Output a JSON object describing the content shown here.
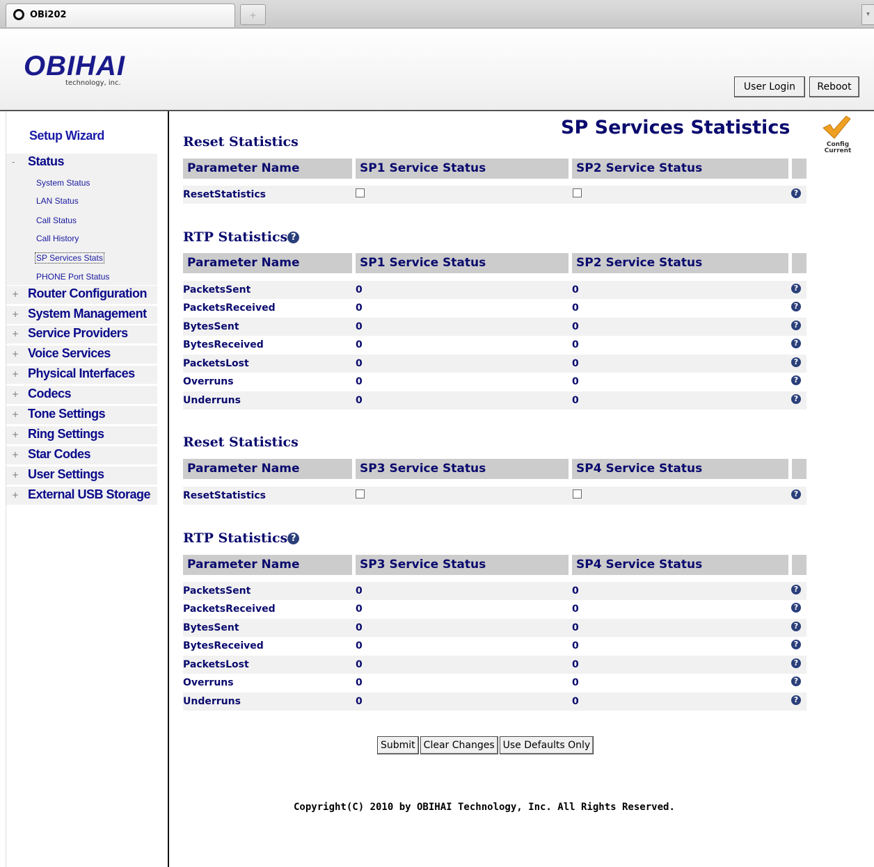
{
  "browser": {
    "tab_title": "OBi202",
    "new_tab": "+",
    "scroll": "▾"
  },
  "header": {
    "logo": "OBIHAI",
    "logo_sub": "technology, inc.",
    "user_login": "User Login",
    "reboot": "Reboot"
  },
  "sidebar": {
    "setup_wizard": "Setup Wizard",
    "status": {
      "label": "Status",
      "toggle": "-"
    },
    "status_items": [
      "System Status",
      "LAN Status",
      "Call Status",
      "Call History",
      "SP Services Stats",
      "PHONE Port Status"
    ],
    "active_item": "SP Services Stats",
    "groups": [
      "Router Configuration",
      "System Management",
      "Service Providers",
      "Voice Services",
      "Physical Interfaces",
      "Codecs",
      "Tone Settings",
      "Ring Settings",
      "Star Codes",
      "User Settings",
      "External USB Storage"
    ],
    "group_toggle": "+"
  },
  "main": {
    "page_title": "SP Services Statistics",
    "config_status": "Config Current",
    "help_glyph": "?",
    "header_param": "Parameter Name",
    "reset_title": "Reset Statistics",
    "rtp_title": "RTP Statistics",
    "block1": {
      "col_a": "SP1 Service Status",
      "col_b": "SP2 Service Status",
      "reset_param": "ResetStatistics",
      "reset_a_checked": false,
      "reset_b_checked": false,
      "rtp_rows": [
        {
          "name": "PacketsSent",
          "a": "0",
          "b": "0"
        },
        {
          "name": "PacketsReceived",
          "a": "0",
          "b": "0"
        },
        {
          "name": "BytesSent",
          "a": "0",
          "b": "0"
        },
        {
          "name": "BytesReceived",
          "a": "0",
          "b": "0"
        },
        {
          "name": "PacketsLost",
          "a": "0",
          "b": "0"
        },
        {
          "name": "Overruns",
          "a": "0",
          "b": "0"
        },
        {
          "name": "Underruns",
          "a": "0",
          "b": "0"
        }
      ]
    },
    "block2": {
      "col_a": "SP3 Service Status",
      "col_b": "SP4 Service Status",
      "reset_param": "ResetStatistics",
      "reset_a_checked": false,
      "reset_b_checked": false,
      "rtp_rows": [
        {
          "name": "PacketsSent",
          "a": "0",
          "b": "0"
        },
        {
          "name": "PacketsReceived",
          "a": "0",
          "b": "0"
        },
        {
          "name": "BytesSent",
          "a": "0",
          "b": "0"
        },
        {
          "name": "BytesReceived",
          "a": "0",
          "b": "0"
        },
        {
          "name": "PacketsLost",
          "a": "0",
          "b": "0"
        },
        {
          "name": "Overruns",
          "a": "0",
          "b": "0"
        },
        {
          "name": "Underruns",
          "a": "0",
          "b": "0"
        }
      ]
    },
    "buttons": {
      "submit": "Submit",
      "clear": "Clear Changes",
      "defaults": "Use Defaults Only"
    },
    "copyright": "Copyright(C) 2010 by OBIHAI Technology, Inc. All Rights Reserved."
  },
  "colors": {
    "nav_text": "#0a0a8a",
    "header_bg": "#cccccc",
    "alt_row": "#f1f1f1",
    "check": "#f0a020"
  },
  "icons": [
    "opera-icon",
    "help-icon",
    "checkmark-icon",
    "expand-icon",
    "collapse-icon"
  ]
}
